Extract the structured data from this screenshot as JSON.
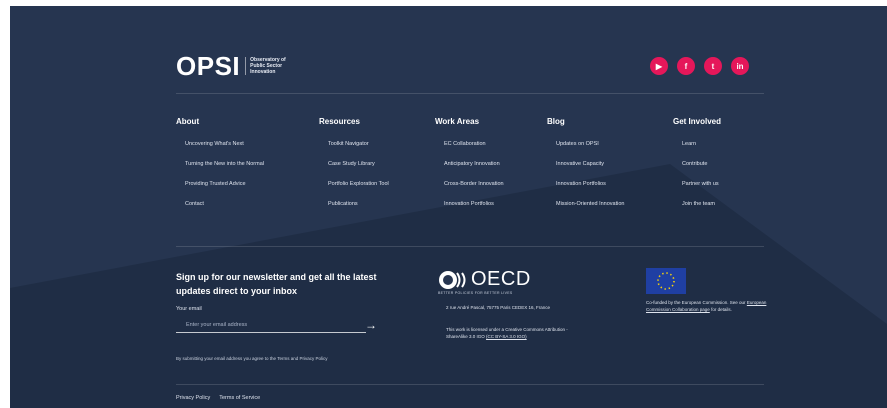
{
  "brand": {
    "logo": "OPSI",
    "subtitle_lines": [
      "Observatory of",
      "Public Sector",
      "Innovation"
    ]
  },
  "social": [
    {
      "icon": "youtube-icon",
      "glyph": "▶"
    },
    {
      "icon": "facebook-icon",
      "glyph": "f"
    },
    {
      "icon": "twitter-icon",
      "glyph": "t"
    },
    {
      "icon": "linkedin-icon",
      "glyph": "in"
    }
  ],
  "columns": [
    {
      "title": "About",
      "items": [
        "Uncovering What's Next",
        "Turning the New into the Normal",
        "Providing Trusted Advice",
        "Contact"
      ]
    },
    {
      "title": "Resources",
      "items": [
        "Toolkit Navigator",
        "Case Study Library",
        "Portfolio Exploration Tool",
        "Publications"
      ]
    },
    {
      "title": "Work Areas",
      "items": [
        "EC Collaboration",
        "Anticipatory Innovation",
        "Cross-Border Innovation",
        "Innovation Portfolios"
      ]
    },
    {
      "title": "Blog",
      "items": [
        "Updates on OPSI",
        "Innovative Capacity",
        "Innovation Portfolios",
        "Mission-Oriented Innovation"
      ]
    },
    {
      "title": "Get Involved",
      "items": [
        "Learn",
        "Contribute",
        "Partner with us",
        "Join the team"
      ]
    }
  ],
  "newsletter": {
    "title": "Sign up for our newsletter and get all the latest updates direct to your inbox",
    "email_label": "Your email",
    "email_placeholder": "Enter your email address",
    "submit_glyph": "→",
    "consent": "By submitting your email address you agree to the Terms and Privacy Policy"
  },
  "oecd": {
    "logo": "OECD",
    "tagline": "BETTER POLICIES FOR BETTER LIVES",
    "address": "2 rue André Pascal, 75775 Paris CEDEX 16, France",
    "license_text": "This work is licensed under a Creative Commons Attribution - ShareAlike 3.0 IGO",
    "license_code": "(CC BY-SA 3.0 IGO)"
  },
  "eu": {
    "text_before": "Co-funded by the European Commission. See our",
    "link": "European Commission Collaboration page",
    "text_after": "for details."
  },
  "bottom_links": [
    "Privacy Policy",
    "Terms of Service"
  ],
  "colors": {
    "background": "#263550",
    "social": "#e5175a",
    "eu_blue": "#1f3fa3",
    "eu_star": "#f6d20a"
  }
}
